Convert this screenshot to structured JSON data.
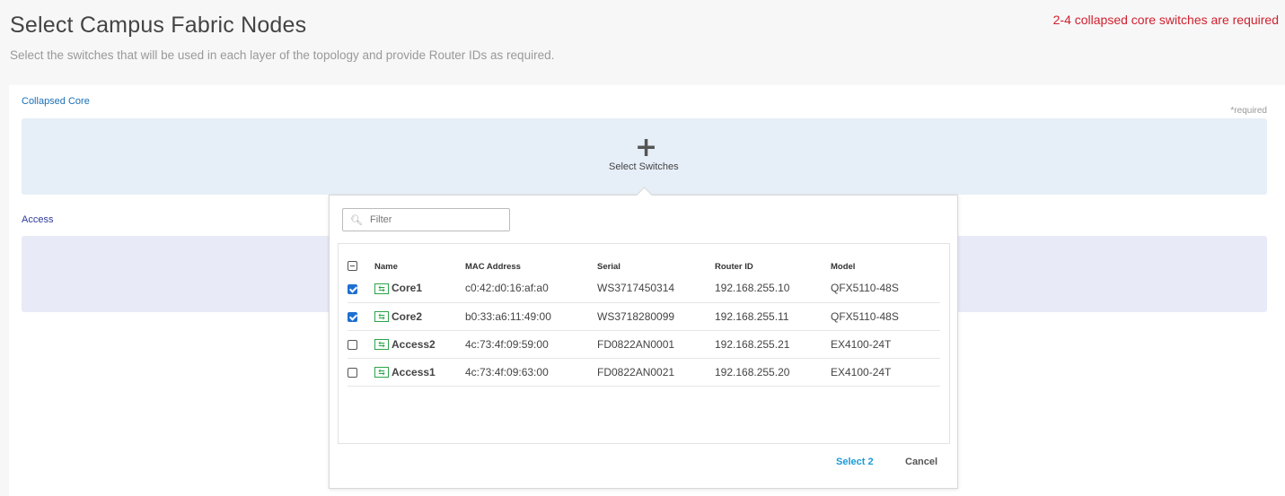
{
  "header": {
    "title": "Select Campus Fabric Nodes",
    "subtitle": "Select the switches that will be used in each layer of the topology and provide Router IDs as required.",
    "error": "2-4 collapsed core switches are required"
  },
  "sections": {
    "core_label": "Collapsed Core",
    "required": "*required",
    "select_switches": "Select Switches",
    "access_label": "Access"
  },
  "popup": {
    "filter_placeholder": "Filter",
    "columns": [
      "Name",
      "MAC Address",
      "Serial",
      "Router ID",
      "Model"
    ],
    "rows": [
      {
        "name": "Core1",
        "mac": "c0:42:d0:16:af:a0",
        "serial": "WS3717450314",
        "router_id": "192.168.255.10",
        "model": "QFX5110-48S",
        "checked": true
      },
      {
        "name": "Core2",
        "mac": "b0:33:a6:11:49:00",
        "serial": "WS3718280099",
        "router_id": "192.168.255.11",
        "model": "QFX5110-48S",
        "checked": true
      },
      {
        "name": "Access2",
        "mac": "4c:73:4f:09:59:00",
        "serial": "FD0822AN0001",
        "router_id": "192.168.255.21",
        "model": "EX4100-24T",
        "checked": false
      },
      {
        "name": "Access1",
        "mac": "4c:73:4f:09:63:00",
        "serial": "FD0822AN0021",
        "router_id": "192.168.255.20",
        "model": "EX4100-24T",
        "checked": false
      }
    ],
    "select_label": "Select 2",
    "cancel_label": "Cancel"
  }
}
